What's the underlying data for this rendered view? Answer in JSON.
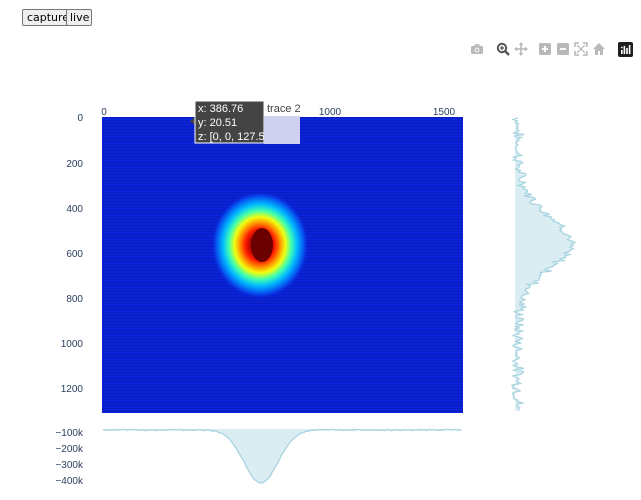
{
  "toolbar": {
    "capture_label": "capture",
    "live_label": "live"
  },
  "modebar": {
    "icons": [
      "camera-icon",
      "zoom-icon",
      "pan-icon",
      "zoom-in-icon",
      "zoom-out-icon",
      "autoscale-icon",
      "home-icon",
      "plotly-logo-icon"
    ]
  },
  "plot": {
    "x_ticks": [
      "0",
      "1000",
      "1500"
    ],
    "y_ticks": [
      "0",
      "200",
      "400",
      "600",
      "800",
      "1000",
      "1200"
    ],
    "bottom_ticks": [
      "−100k",
      "−200k",
      "−300k",
      "−400k"
    ],
    "hover": {
      "x": "x: 386.76",
      "y": "y: 20.51",
      "z": "z: [0, 0, 127.5]",
      "trace": "trace 2"
    },
    "colors": {
      "profile_fill": "#d9edf2",
      "profile_line": "#a8d4e0",
      "image_bg": "#0a22d8",
      "hover_bg": "#444444"
    }
  }
}
